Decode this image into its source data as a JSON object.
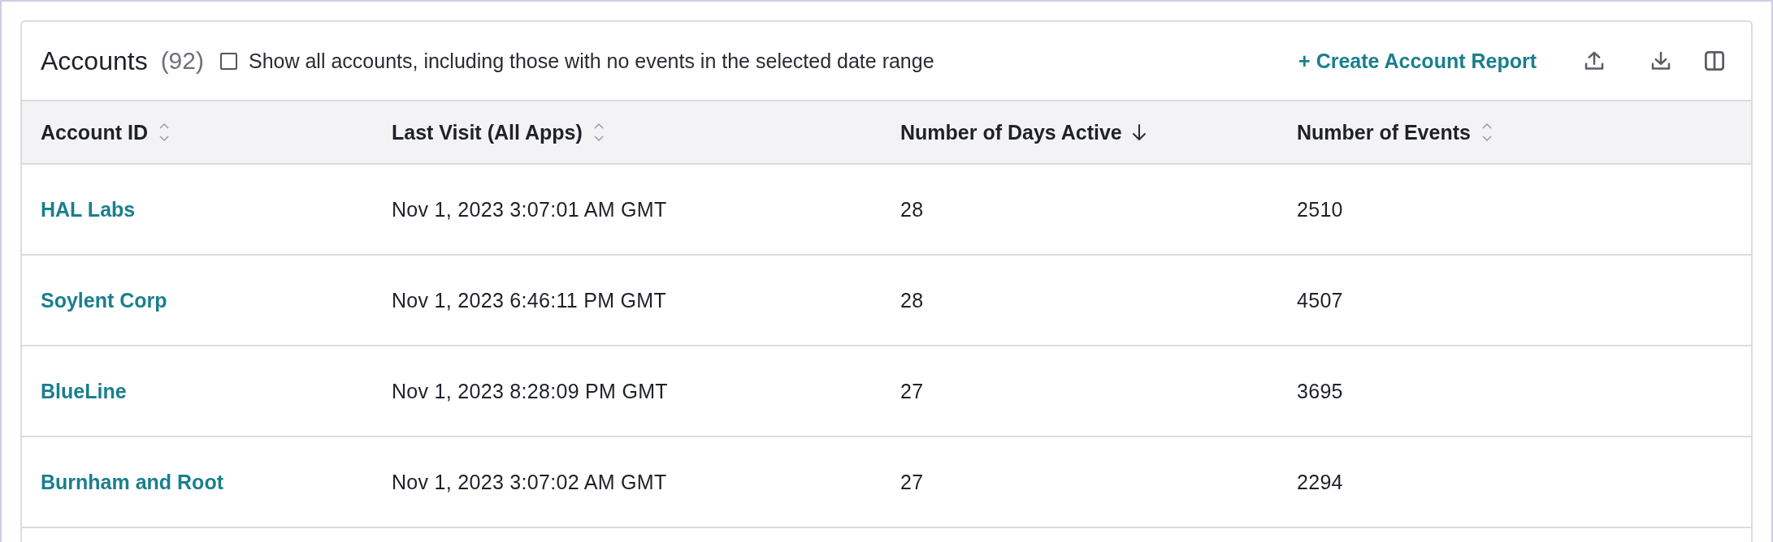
{
  "panel": {
    "title": "Accounts",
    "count": "(92)",
    "show_all": {
      "label": "Show all accounts, including those with no events in the selected date range",
      "checked": false
    },
    "create_link": "+ Create Account Report"
  },
  "table": {
    "columns": [
      {
        "label": "Account ID",
        "sorted": false
      },
      {
        "label": "Last Visit (All Apps)",
        "sorted": false
      },
      {
        "label": "Number of Days Active",
        "sorted": true
      },
      {
        "label": "Number of Events",
        "sorted": false
      }
    ],
    "rows": [
      [
        "HAL Labs",
        "Nov 1, 2023 3:07:01 AM GMT",
        "28",
        "2510"
      ],
      [
        "Soylent Corp",
        "Nov 1, 2023 6:46:11 PM GMT",
        "28",
        "4507"
      ],
      [
        "BlueLine",
        "Nov 1, 2023 8:28:09 PM GMT",
        "27",
        "3695"
      ],
      [
        "Burnham and Root",
        "Nov 1, 2023 3:07:02 AM GMT",
        "27",
        "2294"
      ]
    ]
  }
}
